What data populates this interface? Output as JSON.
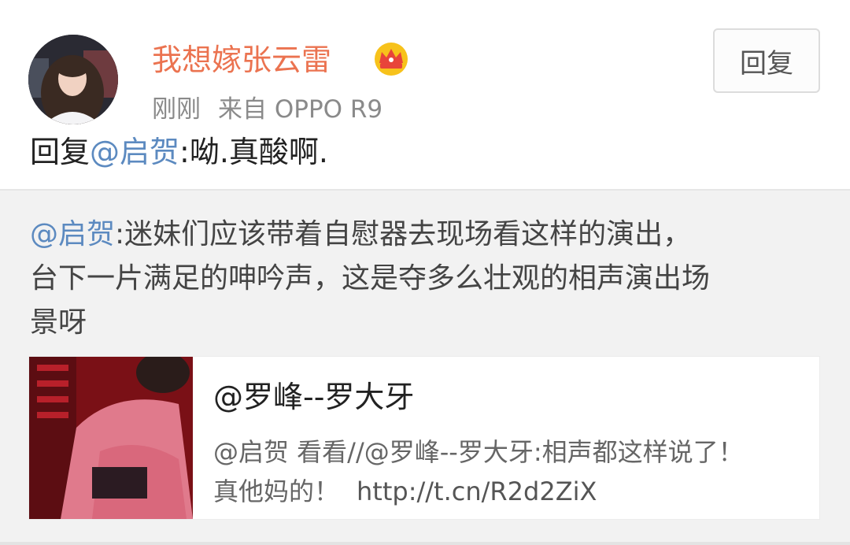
{
  "post": {
    "username": "我想嫁张云雷",
    "time": "刚刚",
    "source": "来自 OPPO R9",
    "reply_button": "回复",
    "reply_prefix": "回复",
    "reply_mention": "@启贺",
    "reply_body": ":呦.真酸啊.",
    "accent_username": "#eb7350",
    "accent_link": "#5c8ac0",
    "badge_icon": "crown-vip-icon"
  },
  "repost": {
    "mention": "@启贺",
    "line1": ":迷妹们应该带着自慰器去现场看这样的演出，",
    "line2": "台下一片满足的呻吟声，这是夺多么壮观的相声演出场",
    "line3": "景呀",
    "card": {
      "title": "@罗峰--罗大牙",
      "desc_line1": "@启贺 看看//@罗峰--罗大牙:相声都这样说了！",
      "desc_line2": "真他妈的！",
      "link": "http://t.cn/R2d2ZiX"
    }
  }
}
